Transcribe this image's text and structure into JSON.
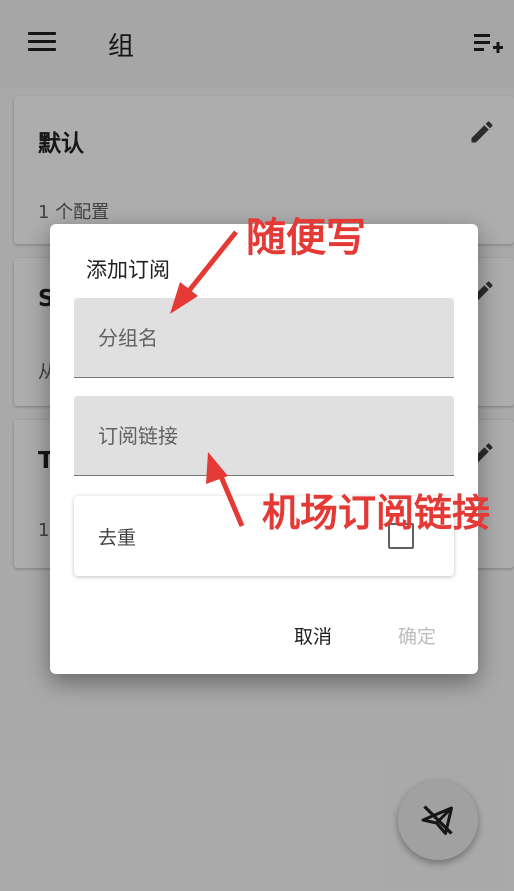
{
  "app_bar": {
    "title": "组",
    "menu_icon": "menu-icon",
    "add_icon": "playlist-add-icon"
  },
  "groups": [
    {
      "title": "默认",
      "subtitle": "1 个配置"
    },
    {
      "title": "S",
      "subtitle": "从"
    },
    {
      "title": "T",
      "subtitle": "1"
    }
  ],
  "fab": {
    "icon": "send-off-icon"
  },
  "dialog": {
    "title": "添加订阅",
    "group_name_placeholder": "分组名",
    "subscription_link_placeholder": "订阅链接",
    "dedupe_label": "去重",
    "dedupe_checked": false,
    "cancel_label": "取消",
    "ok_label": "确定"
  },
  "annotations": {
    "group_name_hint": "随便写",
    "link_hint": "机场订阅链接",
    "color": "#e53935"
  }
}
